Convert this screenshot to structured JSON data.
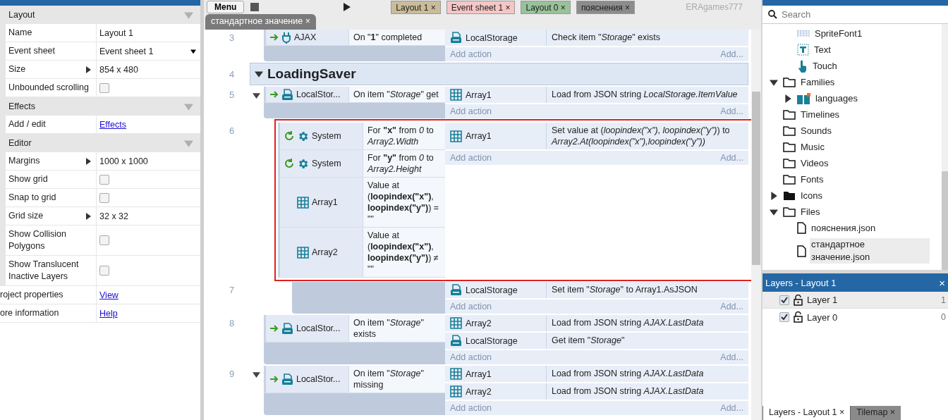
{
  "toolbar": {
    "menu": "Menu",
    "user": "ERAgames777"
  },
  "tabs": [
    {
      "label": "Layout 1",
      "close": "×",
      "color": "#c9bc98"
    },
    {
      "label": "Event sheet 1",
      "close": "×",
      "color": "#f6c6c6"
    },
    {
      "label": "Layout 0",
      "close": "×",
      "color": "#98c29a"
    },
    {
      "label": "пояснения",
      "close": "×",
      "color": "#8c8c8c"
    }
  ],
  "subtabs": [
    {
      "label": "стандартное значение",
      "close": "×"
    }
  ],
  "properties": [
    {
      "kind": "section",
      "label": "Layout",
      "expanded": true
    },
    {
      "kind": "text",
      "label": "Name",
      "value": "Layout 1"
    },
    {
      "kind": "select",
      "label": "Event sheet",
      "value": "Event sheet 1"
    },
    {
      "kind": "text",
      "label": "Size",
      "value": "854 x 480",
      "expandable": true
    },
    {
      "kind": "check",
      "label": "Unbounded scrolling",
      "checked": false
    },
    {
      "kind": "section",
      "label": "Effects",
      "expanded": true
    },
    {
      "kind": "link",
      "label": "Add / edit",
      "value": "Effects"
    },
    {
      "kind": "section",
      "label": "Editor",
      "expanded": true
    },
    {
      "kind": "text",
      "label": "Margins",
      "value": "1000 x 1000",
      "expandable": true
    },
    {
      "kind": "check",
      "label": "Show grid",
      "checked": false
    },
    {
      "kind": "check",
      "label": "Snap to grid",
      "checked": false
    },
    {
      "kind": "text",
      "label": "Grid size",
      "value": "32 x 32",
      "expandable": true
    },
    {
      "kind": "check",
      "label": "Show Collision Polygons",
      "checked": false
    },
    {
      "kind": "check",
      "label": "Show Translucent Inactive Layers",
      "checked": false
    },
    {
      "kind": "toplink",
      "label": "roject properties",
      "value": "View"
    },
    {
      "kind": "toplink",
      "label": "ore information",
      "value": "Help"
    }
  ],
  "events": [
    {
      "kind": "event",
      "number": "3",
      "conditions": [
        {
          "kind": "trigger",
          "object": {
            "kind": "ajax",
            "label": "AJAX"
          },
          "text": "On \"**1**\" completed"
        }
      ],
      "actions": [
        {
          "object": {
            "kind": "storage",
            "label": "LocalStorage"
          },
          "text": "Check item \"*Storage*\" exists"
        }
      ],
      "add_action": "Add action",
      "add_more": "Add..."
    },
    {
      "kind": "group",
      "number": "4",
      "title": "LoadingSaver",
      "expanded": true,
      "children": [
        {
          "kind": "event",
          "number": "5",
          "expanded": true,
          "conditions": [
            {
              "kind": "trigger",
              "object": {
                "kind": "storage",
                "label": "LocalStor..."
              },
              "text": "On item \"*Storage*\" get"
            }
          ],
          "actions": [
            {
              "object": {
                "kind": "array",
                "label": "Array1"
              },
              "text": "Load from JSON string *LocalStorage.ItemValue*"
            }
          ],
          "add_action": "Add action",
          "add_more": "Add...",
          "children": [
            {
              "kind": "event",
              "number": "6",
              "highlighted": true,
              "conditions": [
                {
                  "kind": "loop",
                  "object": {
                    "kind": "system",
                    "label": "System"
                  },
                  "text": "For **\"x\"** from *0* to *Array2.Width*"
                },
                {
                  "kind": "loop",
                  "object": {
                    "kind": "system",
                    "label": "System"
                  },
                  "text": "For **\"y\"** from *0* to *Array2.Height*"
                },
                {
                  "kind": "compare",
                  "object": {
                    "kind": "array",
                    "label": "Array1"
                  },
                  "text": "Value at (**loopindex(\"x\")**, **loopindex(\"y\")**) = \"\""
                },
                {
                  "kind": "compare",
                  "object": {
                    "kind": "array",
                    "label": "Array2"
                  },
                  "text": "Value at (**loopindex(\"x\")**, **loopindex(\"y\")**) ≠ \"\""
                }
              ],
              "actions": [
                {
                  "object": {
                    "kind": "array",
                    "label": "Array1"
                  },
                  "text": "Set value at (*loopindex(\"x\")*, *loopindex(\"y\")*) to *Array2.At(loopindex(\"x\"),loopindex(\"y\"))*"
                }
              ],
              "add_action": "Add action",
              "add_more": "Add...",
              "children": [
                {
                  "kind": "event",
                  "number": "7",
                  "actions": [
                    {
                      "object": {
                        "kind": "storage",
                        "label": "LocalStorage"
                      },
                      "text": "Set item \"*Storage*\" to Array1.AsJSON"
                    }
                  ],
                  "add_action": "Add action",
                  "add_more": "Add..."
                }
              ]
            }
          ]
        },
        {
          "kind": "event",
          "number": "8",
          "conditions": [
            {
              "kind": "trigger",
              "object": {
                "kind": "storage",
                "label": "LocalStor..."
              },
              "text": "On item \"*Storage*\" exists"
            }
          ],
          "actions": [
            {
              "object": {
                "kind": "array",
                "label": "Array2"
              },
              "text": "Load from JSON string *AJAX.LastData*"
            },
            {
              "object": {
                "kind": "storage",
                "label": "LocalStorage"
              },
              "text": "Get item \"*Storage*\""
            }
          ],
          "add_action": "Add action",
          "add_more": "Add..."
        },
        {
          "kind": "event",
          "number": "9",
          "expanded": true,
          "conditions": [
            {
              "kind": "trigger",
              "object": {
                "kind": "storage",
                "label": "LocalStor..."
              },
              "text": "On item \"*Storage*\" missing"
            }
          ],
          "actions": [
            {
              "object": {
                "kind": "array",
                "label": "Array1"
              },
              "text": "Load from JSON string *AJAX.LastData*"
            },
            {
              "object": {
                "kind": "array",
                "label": "Array2"
              },
              "text": "Load from JSON string *AJAX.LastData*"
            }
          ],
          "add_action": "Add action",
          "add_more": "Add..."
        }
      ]
    }
  ],
  "project": {
    "search": {
      "placeholder": "Search"
    },
    "tree": [
      {
        "children": [
          {
            "label": "SpriteFont1",
            "kind": "spritefont",
            "selected": false
          },
          {
            "label": "Text",
            "kind": "text",
            "selected": false
          },
          {
            "label": "Touch",
            "kind": "touch",
            "selected": false
          }
        ]
      },
      {
        "label": "Families",
        "kind": "folder",
        "expanded": true,
        "selected": false,
        "children": [
          {
            "label": "languages",
            "kind": "family",
            "expanded": false,
            "selected": false
          }
        ]
      },
      {
        "label": "Timelines",
        "kind": "folder",
        "selected": false
      },
      {
        "label": "Sounds",
        "kind": "folder",
        "selected": false
      },
      {
        "label": "Music",
        "kind": "folder",
        "selected": false
      },
      {
        "label": "Videos",
        "kind": "folder",
        "selected": false
      },
      {
        "label": "Fonts",
        "kind": "folder",
        "selected": false
      },
      {
        "label": "Icons",
        "kind": "folder-filled",
        "expanded": false,
        "selected": false
      },
      {
        "label": "Files",
        "kind": "folder",
        "expanded": true,
        "selected": false,
        "children": [
          {
            "label": "пояснения.json",
            "kind": "file",
            "selected": false
          },
          {
            "label": "стандартное значение.json",
            "kind": "file",
            "selected": true
          }
        ]
      }
    ]
  },
  "layers": {
    "title": "Layers - Layout 1",
    "close": "×",
    "rows": [
      {
        "name": "Layer 1",
        "visible": true,
        "locked": false,
        "index": "1",
        "selected": true
      },
      {
        "name": "Layer 0",
        "visible": true,
        "locked": false,
        "index": "0",
        "selected": false
      }
    ],
    "bottom_tabs": [
      {
        "label": "Layers - Layout 1",
        "close": "×",
        "selected": true
      },
      {
        "label": "Tilemap",
        "close": "×",
        "selected": false
      }
    ]
  }
}
